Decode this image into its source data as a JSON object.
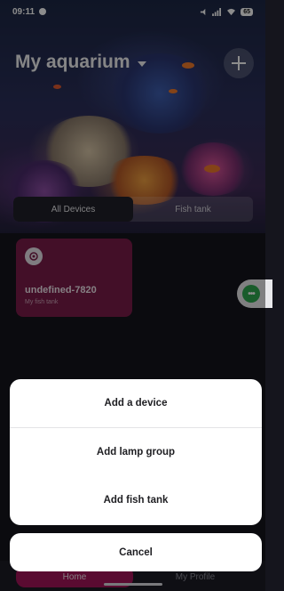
{
  "status_bar": {
    "time": "09:11",
    "battery": "65"
  },
  "header": {
    "title": "My aquarium"
  },
  "tabs": [
    {
      "label": "All Devices",
      "active": true
    },
    {
      "label": "Fish tank",
      "active": false
    }
  ],
  "device_card": {
    "name": "undefined-7820",
    "subtitle": "My fish tank",
    "color": "#7a1d49"
  },
  "action_sheet": {
    "items": [
      {
        "label": "Add a device"
      },
      {
        "label": "Add lamp group"
      },
      {
        "label": "Add fish tank"
      }
    ],
    "cancel_label": "Cancel"
  },
  "bottom_nav": {
    "items": [
      {
        "label": "Home",
        "active": true
      },
      {
        "label": "My Profile",
        "active": false
      }
    ],
    "accent": "#a5155a"
  },
  "icons": {
    "add": "plus-icon",
    "dropdown": "chevron-down-icon",
    "device": "device-icon",
    "more": "more-icon"
  }
}
